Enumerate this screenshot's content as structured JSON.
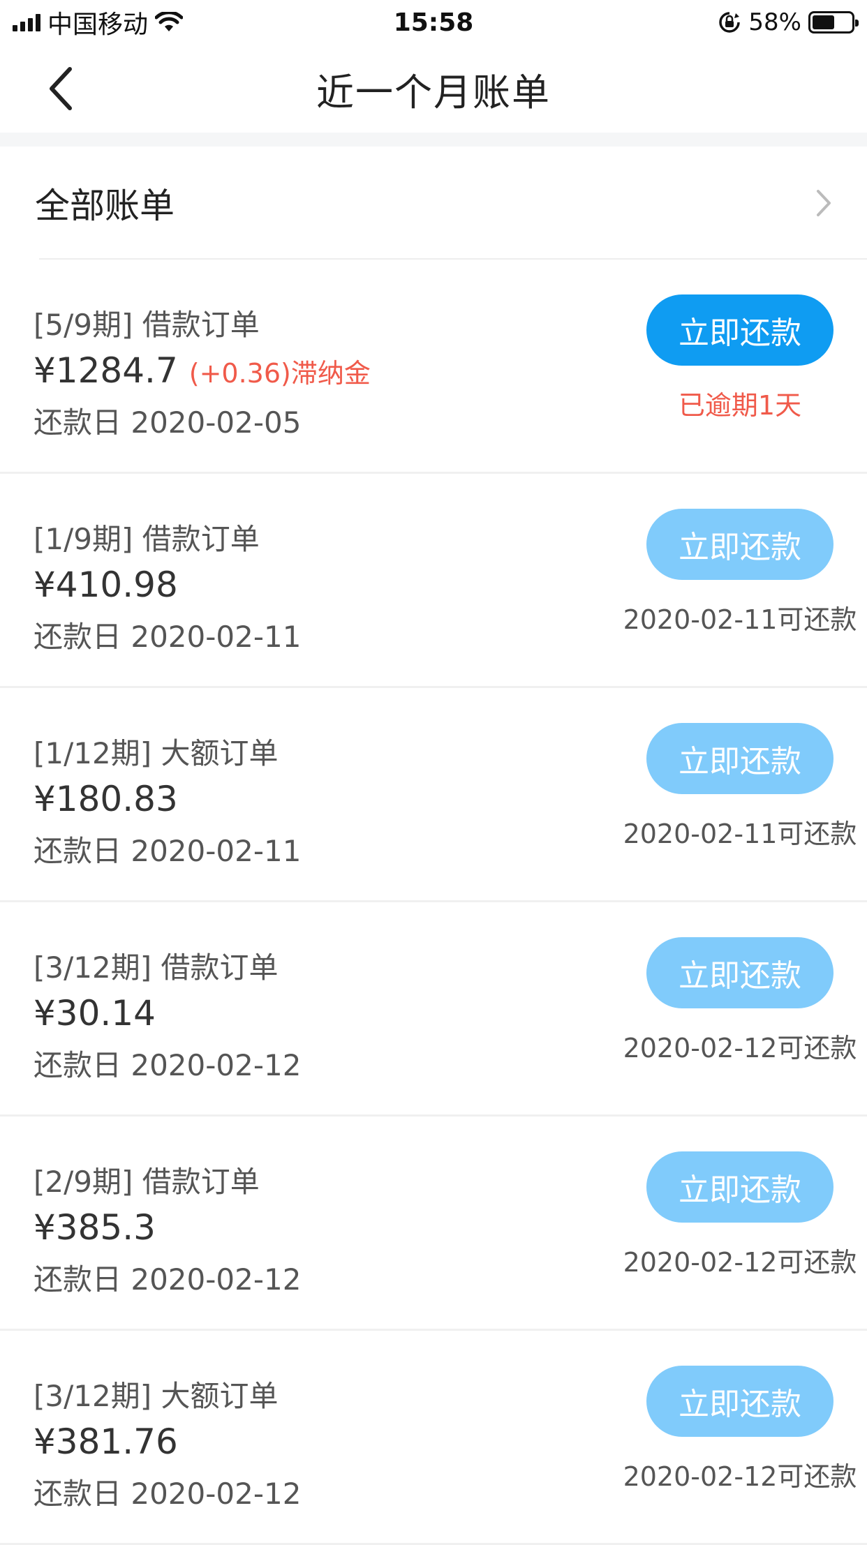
{
  "status_bar": {
    "carrier": "中国移动",
    "time": "15:58",
    "battery": "58%",
    "battery_level": 0.58
  },
  "header": {
    "title": "近一个月账单"
  },
  "all_bills": {
    "label": "全部账单"
  },
  "bills": [
    {
      "period": "[5/9期] 借款订单",
      "amount": "¥1284.7",
      "late_fee": "(+0.36)滞纳金",
      "due": "还款日 2020-02-05",
      "button": "立即还款",
      "button_state": "active",
      "status": "已逾期1天",
      "status_type": "overdue"
    },
    {
      "period": "[1/9期] 借款订单",
      "amount": "¥410.98",
      "late_fee": "",
      "due": "还款日 2020-02-11",
      "button": "立即还款",
      "button_state": "disabled",
      "status": "2020-02-11可还款",
      "status_type": "normal"
    },
    {
      "period": "[1/12期] 大额订单",
      "amount": "¥180.83",
      "late_fee": "",
      "due": "还款日 2020-02-11",
      "button": "立即还款",
      "button_state": "disabled",
      "status": "2020-02-11可还款",
      "status_type": "normal"
    },
    {
      "period": "[3/12期] 借款订单",
      "amount": "¥30.14",
      "late_fee": "",
      "due": "还款日 2020-02-12",
      "button": "立即还款",
      "button_state": "disabled",
      "status": "2020-02-12可还款",
      "status_type": "normal"
    },
    {
      "period": "[2/9期] 借款订单",
      "amount": "¥385.3",
      "late_fee": "",
      "due": "还款日 2020-02-12",
      "button": "立即还款",
      "button_state": "disabled",
      "status": "2020-02-12可还款",
      "status_type": "normal"
    },
    {
      "period": "[3/12期] 大额订单",
      "amount": "¥381.76",
      "late_fee": "",
      "due": "还款日 2020-02-12",
      "button": "立即还款",
      "button_state": "disabled",
      "status": "2020-02-12可还款",
      "status_type": "normal"
    }
  ],
  "colors": {
    "primary": "#0f9cf2",
    "primary_disabled": "#80cbfb",
    "danger": "#f05a4a"
  }
}
